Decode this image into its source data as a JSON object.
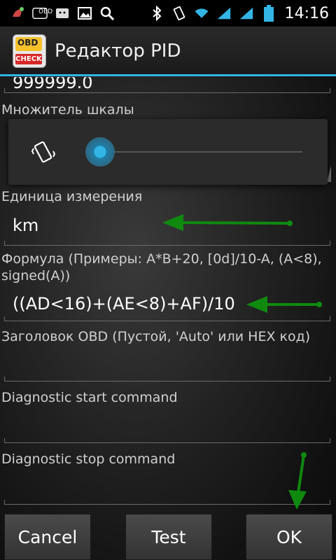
{
  "status_bar": {
    "left_icons": [
      "alert-icon",
      "obd-icon",
      "android-icon",
      "image-icon",
      "search-icon"
    ],
    "right_icons": [
      "bluetooth-icon",
      "vibrate-icon",
      "wifi-icon",
      "signal-icon",
      "signal-icon-2",
      "battery-icon"
    ],
    "obd_label": "OBD",
    "time": "14:16"
  },
  "app_bar": {
    "title": "Редактор PID",
    "icon_text_top": "OBD",
    "icon_text_bottom": "CHECK"
  },
  "form": {
    "max_value": "999999.0",
    "scale_label": "Множитель шкалы",
    "unit_label": "Единица измерения",
    "unit_value": "km",
    "formula_label": "Формула (Примеры: A*B+20, [0d]/10-A, (A<8), signed(A))",
    "formula_value": "((AD<16)+(AE<8)+AF)/10",
    "header_label": "Заголовок OBD (Пустой, 'Auto' или HEX код)",
    "header_value": "",
    "start_label": "Diagnostic start command",
    "start_value": "",
    "stop_label": "Diagnostic stop command",
    "stop_value": ""
  },
  "volume_popup": {
    "icon": "vibrate-icon",
    "level": 0
  },
  "buttons": {
    "cancel": "Cancel",
    "test": "Test",
    "ok": "OK"
  },
  "colors": {
    "accent": "#33b5e5",
    "annotation_arrow": "#0f8a0f"
  }
}
